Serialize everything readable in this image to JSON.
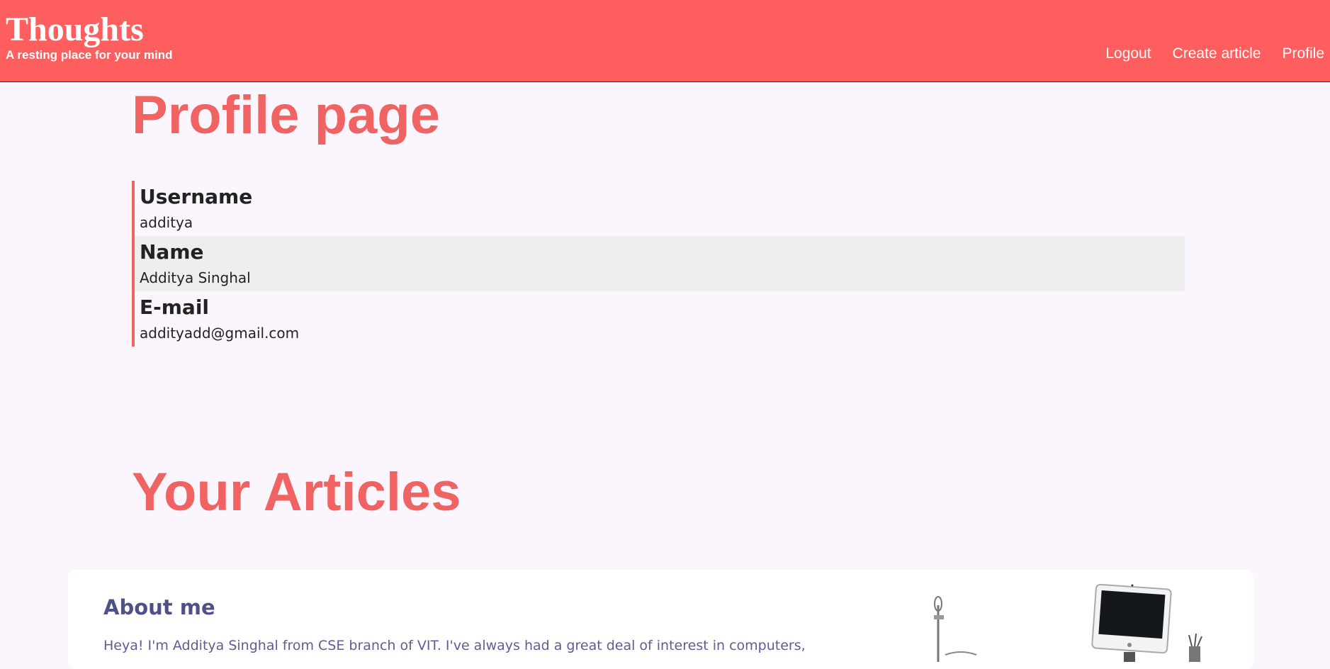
{
  "header": {
    "title": "Thoughts",
    "tagline": "A resting place for your mind",
    "nav": [
      "Logout",
      "Create article",
      "Profile"
    ]
  },
  "page_title": "Profile page",
  "profile": {
    "fields": [
      {
        "label": "Username",
        "value": "additya"
      },
      {
        "label": "Name",
        "value": "Additya Singhal"
      },
      {
        "label": "E-mail",
        "value": "additya​dd@gmail.com"
      }
    ]
  },
  "articles_title": "Your Articles",
  "articles": [
    {
      "title": "About me",
      "excerpt": "Heya! I'm Additya Singhal from CSE branch of VIT. I've always had a great deal of interest in computers,"
    }
  ],
  "colors": {
    "header_bg": "#ff5e5e",
    "accent": "#f06363",
    "page_bg": "#fbf6fd",
    "article_title": "#4e5187"
  }
}
